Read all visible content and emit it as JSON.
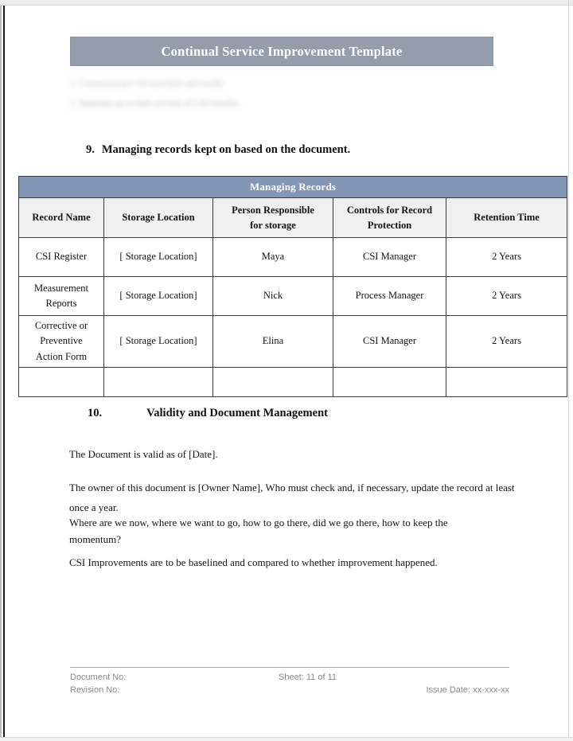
{
  "document": {
    "title": "Continual Service Improvement Template",
    "redacted_lines": [
      "1. Communicate CSI activities and results",
      "2. Maintain up-to-date records of CSI benefits"
    ]
  },
  "section_9": {
    "number": "9.",
    "title": "Managing records kept on based on the document."
  },
  "table": {
    "banner": "Managing Records",
    "columns": [
      "Record Name",
      "Storage Location",
      "Person Responsible for storage",
      "Controls for Record Protection",
      "Retention Time"
    ],
    "column_lines": [
      [
        "Record Name"
      ],
      [
        "Storage Location"
      ],
      [
        "Person Responsible",
        "for storage"
      ],
      [
        "Controls for Record",
        "Protection"
      ],
      [
        "Retention Time"
      ]
    ],
    "rows": [
      {
        "record_name": "CSI Register",
        "record_name_lines": [
          "CSI Register"
        ],
        "storage_location": "[ Storage Location]",
        "person_responsible": "Maya",
        "controls": "CSI Manager",
        "retention_time": "2 Years"
      },
      {
        "record_name": "Measurement Reports",
        "record_name_lines": [
          "Measurement",
          "Reports"
        ],
        "storage_location": "[ Storage Location]",
        "person_responsible": "Nick",
        "controls": "Process Manager",
        "retention_time": "2 Years"
      },
      {
        "record_name": "Corrective or Preventive Action Form",
        "record_name_lines": [
          "Corrective or",
          "Preventive",
          "Action Form"
        ],
        "storage_location": "[ Storage Location]",
        "person_responsible": "Elina",
        "controls": "CSI Manager",
        "retention_time": "2 Years"
      },
      {
        "record_name": "",
        "record_name_lines": [
          ""
        ],
        "storage_location": "",
        "person_responsible": "",
        "controls": "",
        "retention_time": ""
      }
    ]
  },
  "section_10": {
    "number": "10.",
    "title": "Validity and Document Management",
    "paragraphs": {
      "validity": "The Document is valid as of [Date].",
      "owner": "The owner of this document is [Owner Name], Who must check and, if necessary, update the record at least once a year.",
      "questions": "Where are we now, where we want to go, how to go there, did we go there, how to keep the momentum?",
      "improvements": "CSI Improvements are to be baselined and compared to whether improvement happened."
    }
  },
  "footer": {
    "document_no": "Document No:",
    "revision_no": "Revision No:",
    "sheet": "Sheet: 11 of 11",
    "issue_date": "Issue Date: xx-xxx-xx"
  },
  "colors": {
    "title_banner": "#939dab",
    "table_banner": "#8197b5",
    "column_header": "#f0f0f0",
    "border": "#3a3a3a",
    "footer_text": "#8a8a8a"
  }
}
